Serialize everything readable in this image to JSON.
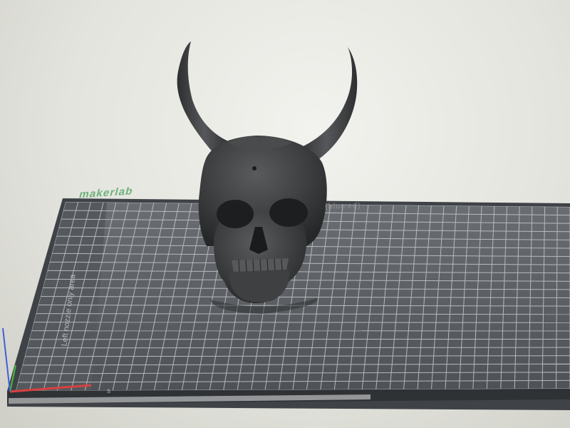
{
  "viewport": {
    "name": "3D slicer build plate view"
  },
  "bed": {
    "brand_text": "makerlab",
    "model_text": "(blurred)",
    "side_label": "Left nozzle only area",
    "corner_label": "s"
  },
  "colors": {
    "background": "#e6e6e0",
    "bed_frame": "#3f4347",
    "bed_surface": "#5e6266",
    "grid_line": "#c5c9cc",
    "model": "#3a3b3c",
    "axis_x": "#d94040",
    "axis_y": "#40c040",
    "axis_z": "#4060d9"
  },
  "model": {
    "name": "horned skull"
  }
}
